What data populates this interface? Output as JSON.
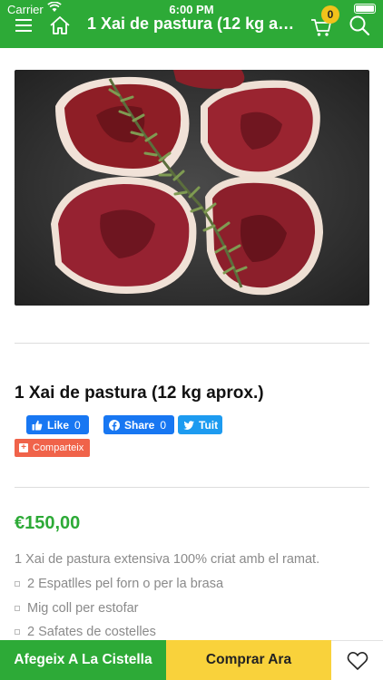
{
  "status_bar": {
    "carrier": "Carrier",
    "time": "6:00 PM"
  },
  "header": {
    "title": "1 Xai de pastura (12 kg ap...",
    "cart_count": "0",
    "icons": [
      "menu-icon",
      "home-icon",
      "cart-icon",
      "search-icon"
    ],
    "background": "#2daa37"
  },
  "product": {
    "title": "1 Xai de pastura (12 kg aprox.)",
    "price": "€150,00",
    "description": "1 Xai de pastura extensiva 100% criat amb el ramat.",
    "items": [
      "2 Espatlles pel forn o per la brasa",
      "Mig coll per estofar",
      "2 Safates de costelles"
    ]
  },
  "social": {
    "like_label": "Like",
    "like_count": "0",
    "share_label": "Share",
    "share_count": "0",
    "tweet_label": "Tuit",
    "share_all_label": "Comparteix"
  },
  "actions": {
    "add_to_cart": "Afegeix A La Cistella",
    "buy_now": "Comprar Ara"
  },
  "colors": {
    "brand_green": "#2daa37",
    "accent_yellow": "#f9d23b",
    "facebook": "#1877f2",
    "twitter": "#1d9bf0",
    "share_red": "#f0634a"
  }
}
